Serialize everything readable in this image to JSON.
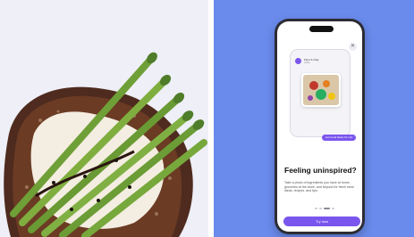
{
  "promo": {
    "heading": "Feeling uninspired?",
    "body": "Take a photo of ingredients you have at home, groceries at the store, and beyond for fresh meal ideas, recipes, and tips.",
    "cta_label": "Try now",
    "chat_bubble": "Get meal ideas for me!",
    "close_glyph": "✕",
    "preview_name": "Flour & Clay",
    "preview_sub": "online"
  },
  "carousel": {
    "page_count": 4,
    "active_index": 2
  },
  "colors": {
    "accent": "#7b56ee",
    "right_background": "#6a8bec",
    "left_background": "#eeeff7"
  },
  "icons": [
    "close-icon",
    "avatar-icon"
  ]
}
